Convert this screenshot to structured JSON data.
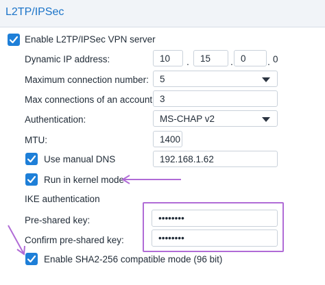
{
  "section": {
    "title": "L2TP/IPSec"
  },
  "enable_vpn": {
    "label": "Enable L2TP/IPSec VPN server",
    "checked": true
  },
  "dynamic_ip": {
    "label": "Dynamic IP address:",
    "octets": [
      "10",
      "15",
      "0",
      "0"
    ]
  },
  "max_connections": {
    "label": "Maximum connection number:",
    "value": "5"
  },
  "max_per_account": {
    "label": "Max connections of an account:",
    "value": "3"
  },
  "authentication": {
    "label": "Authentication:",
    "value": "MS-CHAP v2"
  },
  "mtu": {
    "label": "MTU:",
    "value": "1400"
  },
  "manual_dns": {
    "label": "Use manual DNS",
    "checked": true,
    "value": "192.168.1.62"
  },
  "kernel_mode": {
    "label": "Run in kernel mode",
    "checked": true
  },
  "ike": {
    "heading": "IKE authentication"
  },
  "pre_shared_key": {
    "label": "Pre-shared key:",
    "value": "••••••••"
  },
  "confirm_key": {
    "label": "Confirm pre-shared key:",
    "value": "••••••••"
  },
  "sha2_mode": {
    "label": "Enable SHA2-256 compatible mode (96 bit)",
    "checked": true
  },
  "colors": {
    "accent": "#1e7fd8",
    "title": "#1a73c8",
    "annotation": "#b06bd6"
  },
  "icons": {
    "checkbox": "checkmark-icon",
    "dropdown": "chevron-down-icon",
    "annotation": "arrow-icon"
  }
}
